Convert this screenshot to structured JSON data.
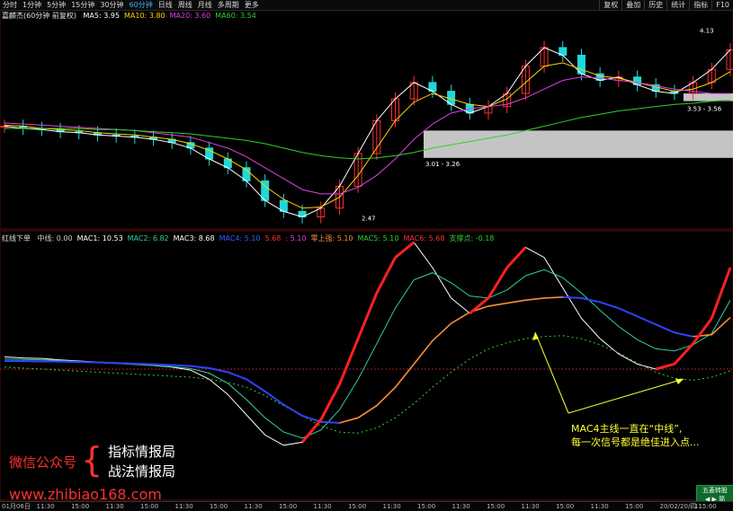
{
  "period_bar": {
    "items": [
      "分时",
      "1分钟",
      "5分钟",
      "15分钟",
      "30分钟",
      "60分钟",
      "日线",
      "周线",
      "月线",
      "多周期",
      "更多"
    ],
    "active_index": 5,
    "right_items": [
      "复权",
      "叠加",
      "历史",
      "统计",
      "指标",
      "F10"
    ]
  },
  "main_panel": {
    "title": "嘉麟杰(60分钟 前复权)",
    "ma": [
      {
        "label": "MA5: 3.95",
        "color": "#ffffff"
      },
      {
        "label": "MA10: 3.80",
        "color": "#ffd200"
      },
      {
        "label": "MA20: 3.60",
        "color": "#e040e0"
      },
      {
        "label": "MA60: 3.54",
        "color": "#30d030"
      }
    ]
  },
  "indicator_panel": {
    "title": "红线下单",
    "items": [
      {
        "label": "中线: 0.00",
        "color": "#cfcfcf"
      },
      {
        "label": "MAC1: 10.53",
        "color": "#ffffff"
      },
      {
        "label": "MAC2: 6.82",
        "color": "#30d0a0"
      },
      {
        "label": "MAC3: 8.68",
        "color": "#ffffff"
      },
      {
        "label": "MAC4: 5.10",
        "color": "#3a5bff"
      },
      {
        "label": "5.68",
        "color": "#ff3030"
      },
      {
        "label": ": 5.10",
        "color": "#e040e0"
      },
      {
        "label": "零上强: 5.10",
        "color": "#ff8c30"
      },
      {
        "label": "MAC5: 5.10",
        "color": "#30d030"
      },
      {
        "label": "MAC6: 5.68",
        "color": "#ff3030"
      },
      {
        "label": "支撑点: -0.18",
        "color": "#30d030"
      }
    ]
  },
  "chart_data": {
    "type": "line",
    "price_labels": [
      "4.13",
      "3.53 - 3.56",
      "3.01 - 3.26",
      "2.47"
    ],
    "series": [
      {
        "values": [
          3.3,
          3.28,
          3.27,
          3.25,
          3.24,
          3.22,
          3.21,
          3.2,
          3.18,
          3.15,
          3.1,
          3.0,
          2.92,
          2.8,
          2.62,
          2.52,
          2.47,
          2.55,
          2.75,
          3.05,
          3.35,
          3.55,
          3.7,
          3.62,
          3.5,
          3.42,
          3.48,
          3.6,
          3.85,
          4.02,
          3.95,
          3.78,
          3.72,
          3.75,
          3.68,
          3.62,
          3.6,
          3.7,
          3.82,
          4.0
        ]
      },
      {
        "values": [
          3.31,
          3.3,
          3.28,
          3.27,
          3.26,
          3.24,
          3.23,
          3.22,
          3.2,
          3.18,
          3.14,
          3.08,
          3.0,
          2.9,
          2.75,
          2.63,
          2.55,
          2.56,
          2.65,
          2.85,
          3.1,
          3.35,
          3.52,
          3.6,
          3.55,
          3.5,
          3.48,
          3.55,
          3.7,
          3.85,
          3.88,
          3.82,
          3.76,
          3.74,
          3.7,
          3.66,
          3.62,
          3.64,
          3.7,
          3.8
        ]
      },
      {
        "values": [
          3.33,
          3.32,
          3.31,
          3.3,
          3.29,
          3.28,
          3.27,
          3.26,
          3.24,
          3.22,
          3.2,
          3.15,
          3.1,
          3.02,
          2.92,
          2.82,
          2.72,
          2.68,
          2.68,
          2.74,
          2.85,
          3.0,
          3.18,
          3.32,
          3.42,
          3.46,
          3.48,
          3.5,
          3.56,
          3.64,
          3.72,
          3.75,
          3.74,
          3.72,
          3.7,
          3.67,
          3.64,
          3.62,
          3.6,
          3.6
        ]
      },
      {
        "values": [
          3.28,
          3.28,
          3.28,
          3.28,
          3.28,
          3.27,
          3.27,
          3.26,
          3.25,
          3.24,
          3.23,
          3.21,
          3.19,
          3.17,
          3.14,
          3.1,
          3.06,
          3.03,
          3.01,
          3.0,
          3.01,
          3.03,
          3.06,
          3.1,
          3.13,
          3.16,
          3.19,
          3.22,
          3.26,
          3.3,
          3.34,
          3.38,
          3.41,
          3.44,
          3.46,
          3.48,
          3.5,
          3.51,
          3.53,
          3.54
        ]
      },
      {
        "values": [
          1.2,
          1.1,
          1.05,
          0.9,
          0.8,
          0.7,
          0.6,
          0.5,
          0.35,
          0.2,
          -0.1,
          -1.0,
          -2.5,
          -4.5,
          -6.5,
          -7.5,
          -7.2,
          -5.0,
          -1.5,
          3.0,
          7.5,
          11.0,
          12.5,
          10.0,
          7.0,
          5.5,
          7.0,
          10.0,
          12.0,
          11.0,
          8.0,
          5.0,
          3.0,
          1.5,
          0.5,
          0.0,
          0.5,
          2.5,
          5.0,
          10.0
        ]
      },
      {
        "values": [
          1.0,
          0.95,
          0.9,
          0.85,
          0.75,
          0.65,
          0.55,
          0.45,
          0.35,
          0.25,
          0.05,
          -0.4,
          -1.4,
          -3.0,
          -4.8,
          -6.2,
          -6.8,
          -6.0,
          -4.0,
          -1.0,
          2.5,
          6.0,
          8.8,
          9.5,
          8.5,
          7.2,
          7.0,
          7.8,
          9.2,
          9.8,
          9.0,
          7.5,
          5.8,
          4.2,
          2.9,
          2.0,
          1.8,
          2.4,
          3.5,
          6.8
        ]
      },
      {
        "values": [
          0.8,
          0.78,
          0.76,
          0.74,
          0.7,
          0.66,
          0.6,
          0.54,
          0.48,
          0.4,
          0.3,
          0.1,
          -0.3,
          -1.0,
          -2.2,
          -3.5,
          -4.6,
          -5.2,
          -5.3,
          -4.8,
          -3.6,
          -1.8,
          0.5,
          2.8,
          4.5,
          5.6,
          6.2,
          6.5,
          6.8,
          7.0,
          7.1,
          7.0,
          6.6,
          6.0,
          5.2,
          4.4,
          3.6,
          3.2,
          3.4,
          5.1
        ]
      },
      {
        "values": [
          0.2,
          0.1,
          0.0,
          -0.1,
          -0.2,
          -0.3,
          -0.4,
          -0.5,
          -0.6,
          -0.7,
          -0.8,
          -1.0,
          -1.3,
          -1.8,
          -2.6,
          -3.6,
          -4.6,
          -5.6,
          -6.2,
          -6.3,
          -5.8,
          -4.8,
          -3.4,
          -1.8,
          -0.3,
          1.0,
          2.0,
          2.6,
          3.0,
          3.2,
          3.3,
          3.0,
          2.4,
          1.6,
          0.6,
          -0.3,
          -0.9,
          -1.1,
          -0.8,
          -0.18
        ]
      }
    ]
  },
  "annotation": {
    "line1": "MAC4主线一直在“中线”,",
    "line2": "每一次信号都是绝佳进入点..."
  },
  "watermark": {
    "left": "微信公众号",
    "brace": "{",
    "right1": "指标情报局",
    "right2": "战法情报局",
    "url": "www.zhibiao168.com"
  },
  "badge": {
    "line1": "五菱转股",
    "line2": "◀ ▶ 简"
  },
  "time_axis": [
    "01月06日",
    "11:30",
    "15:00",
    "11:30",
    "15:00",
    "11:30",
    "15:00",
    "11:30",
    "15:00",
    "11:30",
    "15:00",
    "11:30",
    "15:00",
    "11:30",
    "15:00",
    "11:30",
    "15:00",
    "11:30",
    "15:00",
    "20/02/20/四 15:00",
    "11:"
  ]
}
